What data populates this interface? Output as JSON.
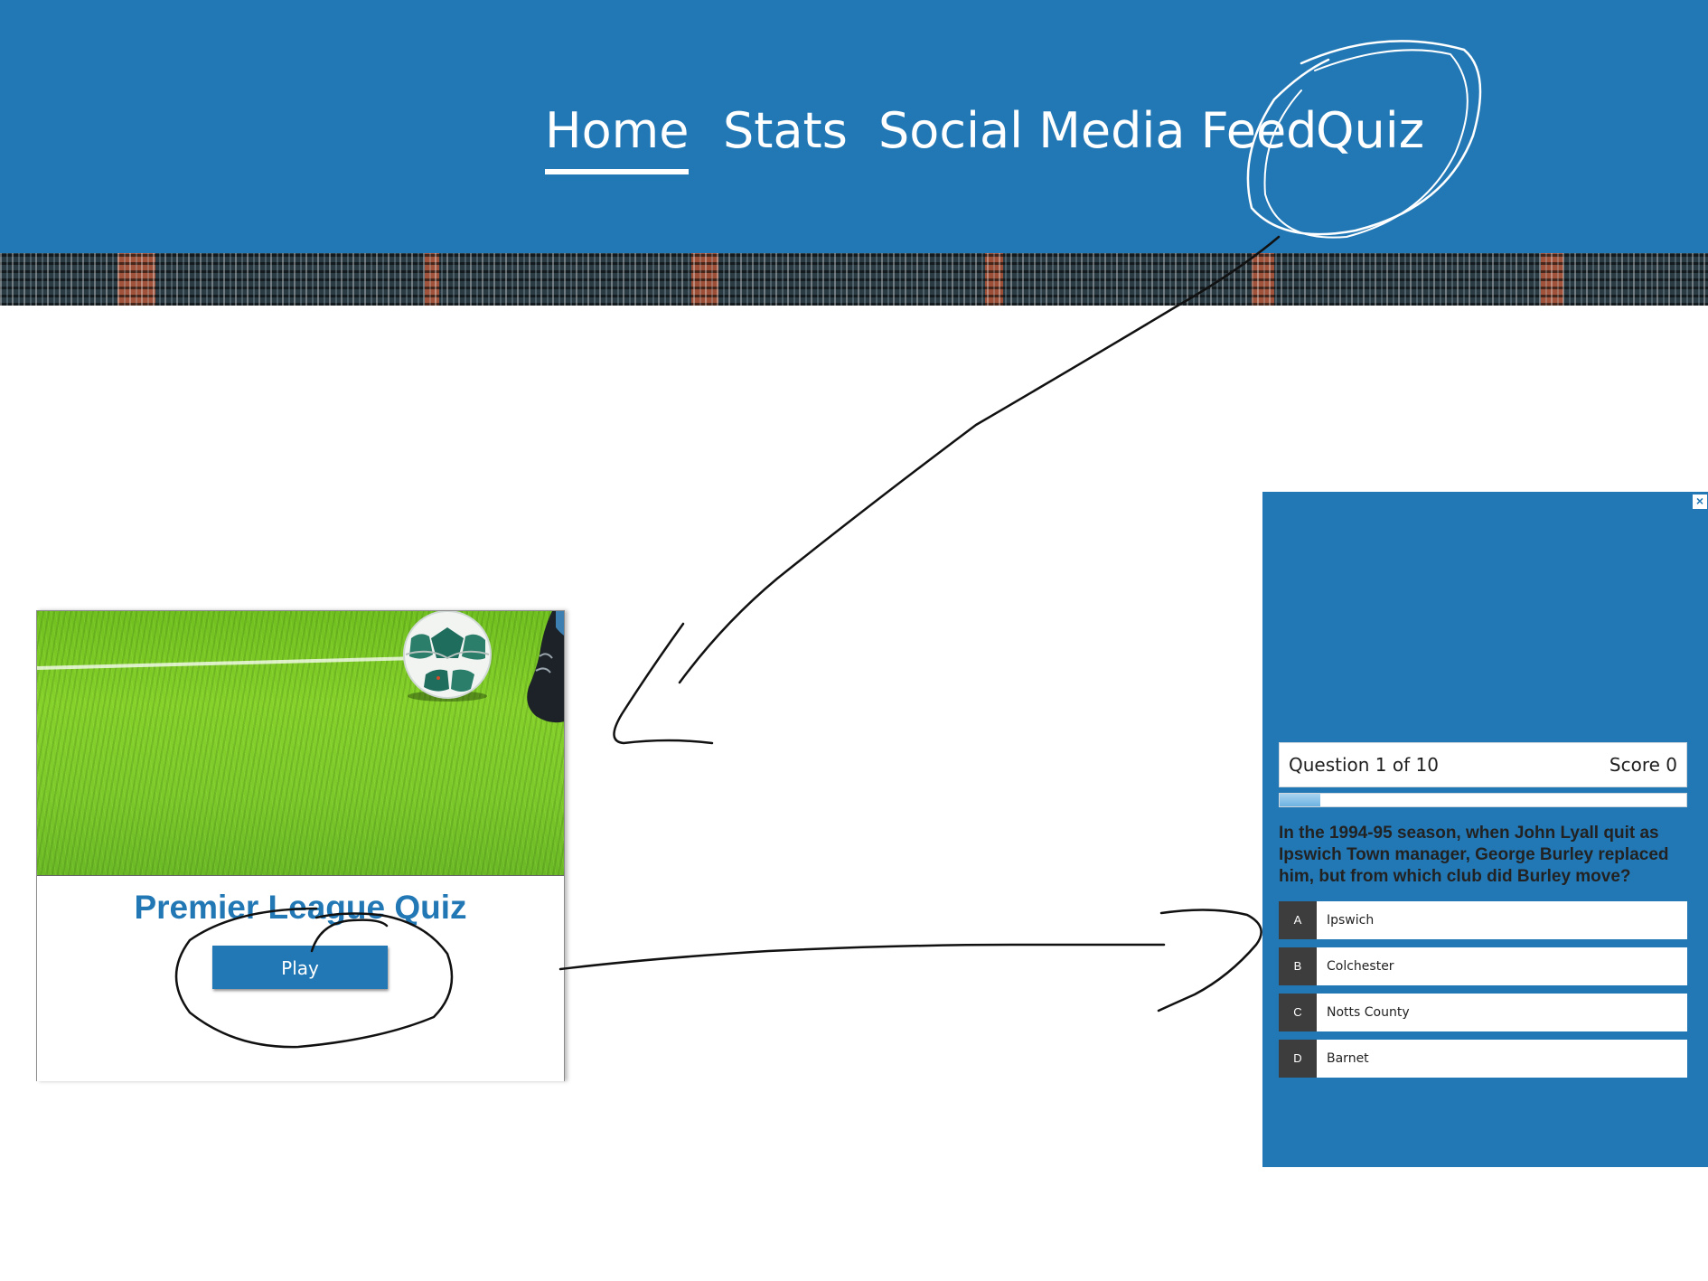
{
  "nav": {
    "items": [
      {
        "label": "Home",
        "active": true
      },
      {
        "label": "Stats",
        "active": false
      },
      {
        "label": "Social Media Feed",
        "active": false
      },
      {
        "label": "Quiz",
        "active": false
      }
    ]
  },
  "card": {
    "title": "Premier League Quiz",
    "play_label": "Play"
  },
  "quiz": {
    "close_icon": "×",
    "status": {
      "question": "Question 1 of 10",
      "score": "Score 0"
    },
    "progress_fraction": 0.1,
    "question": "In the 1994-95 season, when John Lyall quit as Ipswich Town manager, George Burley replaced him, but from which club did Burley move?",
    "answers": [
      {
        "letter": "A",
        "text": "Ipswich"
      },
      {
        "letter": "B",
        "text": "Colchester"
      },
      {
        "letter": "C",
        "text": "Notts County"
      },
      {
        "letter": "D",
        "text": "Barnet"
      }
    ]
  },
  "colors": {
    "brand_blue": "#2278b5",
    "answer_letter_bg": "#3d3d3d",
    "progress_fill": "#6db2e3"
  }
}
